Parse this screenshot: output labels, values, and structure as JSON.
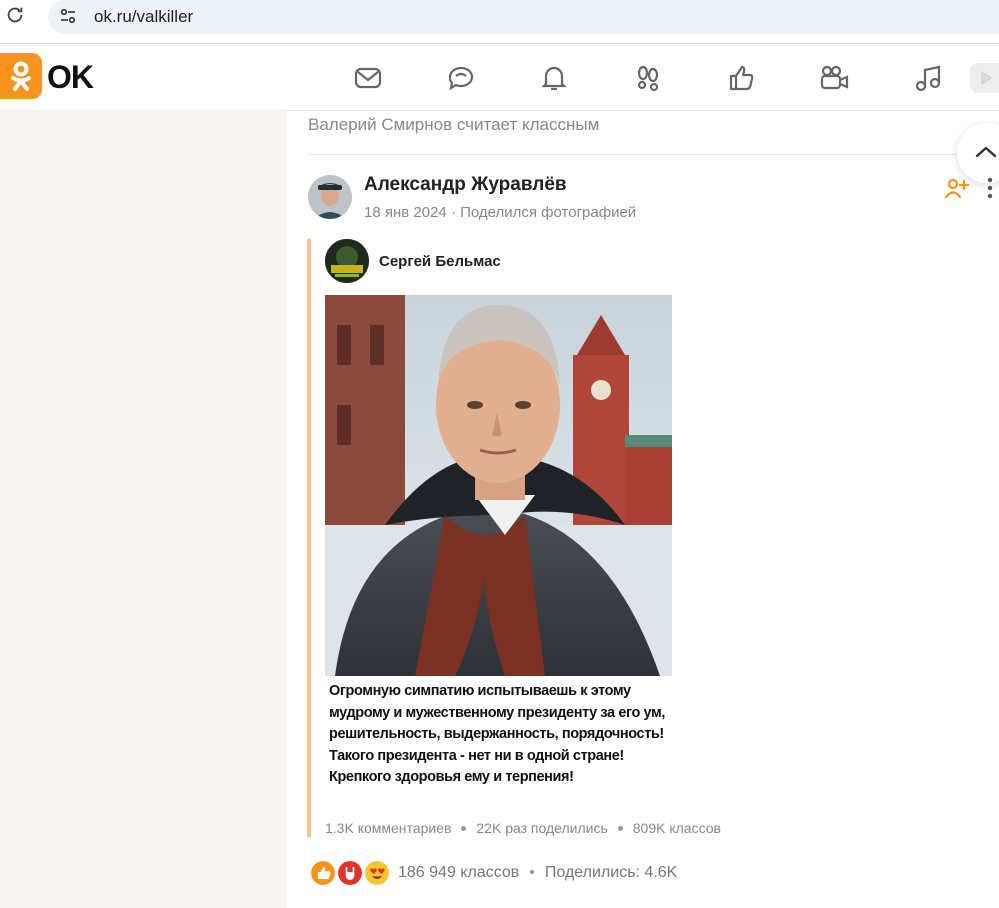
{
  "browser": {
    "url": "ok.ru/valkiller"
  },
  "header": {
    "logo_text": "OK",
    "nav_icons": [
      "messages-icon",
      "discussions-icon",
      "notifications-icon",
      "guests-icon",
      "likes-icon",
      "video-icon",
      "music-icon"
    ],
    "accent": "#f7931e"
  },
  "feed": {
    "liked_by": "Валерий Смирнов считает классным",
    "post": {
      "author": "Александр Журавлёв",
      "date": "18 янв 2024",
      "meta_sep": "·",
      "action": "Поделился фотографией",
      "repost": {
        "author": "Сергей Бельмас",
        "caption": "Огромную симпатию испытываешь к этому мудрому и мужественному президенту за его ум, решительность, выдержанность, порядочность! Такого президента - нет ни в одной стране! Крепкого здоровья ему и терпения!",
        "stats": {
          "comments": "1.3K комментариев",
          "shares": "22K раз поделились",
          "likes": "809K классов"
        }
      },
      "totals": {
        "likes": "186 949 классов",
        "sep": "•",
        "shares": "Поделились: 4.6K"
      }
    }
  }
}
